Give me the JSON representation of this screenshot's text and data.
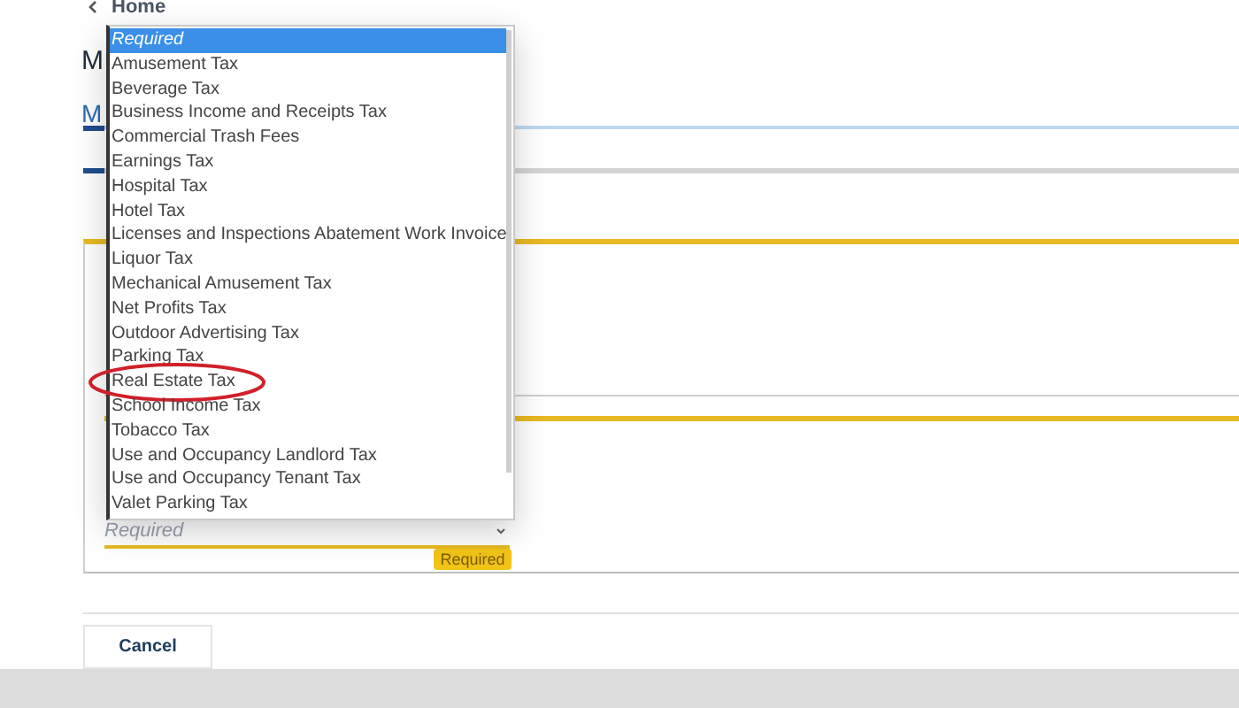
{
  "breadcrumb": {
    "label": "Home"
  },
  "page_title": "M",
  "tab": {
    "label": "M",
    "selected": true
  },
  "tax_select": {
    "placeholder": "Required",
    "badge": "Required"
  },
  "dropdown": {
    "items": [
      {
        "label": "Required",
        "selected": true,
        "circled": false
      },
      {
        "label": "Amusement Tax",
        "selected": false,
        "circled": false
      },
      {
        "label": "Beverage Tax",
        "selected": false,
        "circled": false
      },
      {
        "label": "Business Income and Receipts Tax",
        "selected": false,
        "circled": false
      },
      {
        "label": "Commercial Trash Fees",
        "selected": false,
        "circled": false
      },
      {
        "label": "Earnings Tax",
        "selected": false,
        "circled": false
      },
      {
        "label": "Hospital Tax",
        "selected": false,
        "circled": false
      },
      {
        "label": "Hotel Tax",
        "selected": false,
        "circled": false
      },
      {
        "label": "Licenses and Inspections Abatement Work Invoice",
        "selected": false,
        "circled": false
      },
      {
        "label": "Liquor Tax",
        "selected": false,
        "circled": false
      },
      {
        "label": "Mechanical Amusement Tax",
        "selected": false,
        "circled": false
      },
      {
        "label": "Net Profits Tax",
        "selected": false,
        "circled": false
      },
      {
        "label": "Outdoor Advertising Tax",
        "selected": false,
        "circled": false
      },
      {
        "label": "Parking Tax",
        "selected": false,
        "circled": false
      },
      {
        "label": "Real Estate Tax",
        "selected": false,
        "circled": true
      },
      {
        "label": "School Income Tax",
        "selected": false,
        "circled": false
      },
      {
        "label": "Tobacco Tax",
        "selected": false,
        "circled": false
      },
      {
        "label": "Use and Occupancy Landlord Tax",
        "selected": false,
        "circled": false
      },
      {
        "label": "Use and Occupancy Tenant Tax",
        "selected": false,
        "circled": false
      },
      {
        "label": "Valet Parking Tax",
        "selected": false,
        "circled": false
      }
    ]
  },
  "buttons": {
    "cancel": "Cancel"
  }
}
